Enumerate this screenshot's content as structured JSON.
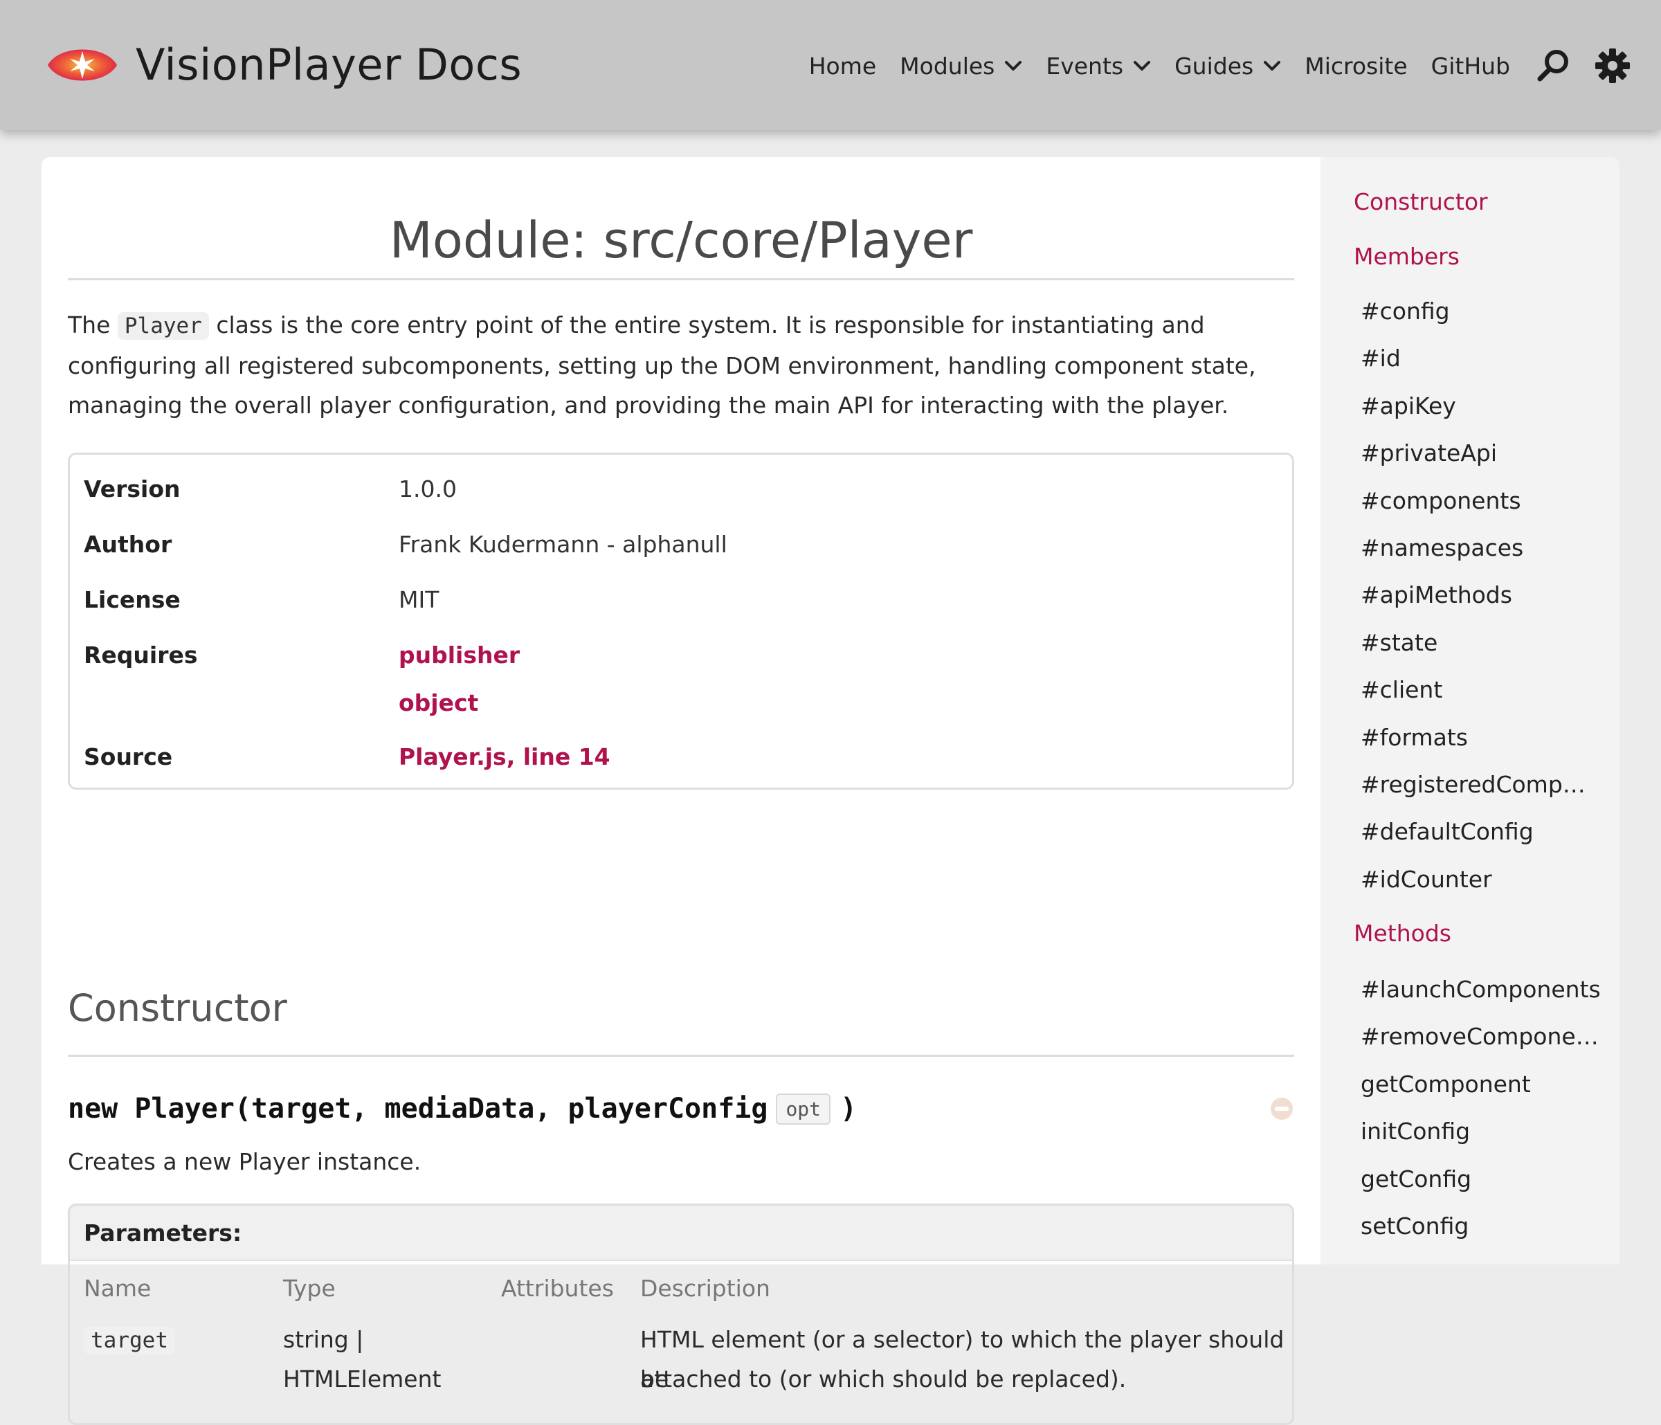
{
  "header": {
    "brand": "VisionPlayer Docs",
    "nav": [
      {
        "label": "Home",
        "dropdown": false
      },
      {
        "label": "Modules",
        "dropdown": true
      },
      {
        "label": "Events",
        "dropdown": true
      },
      {
        "label": "Guides",
        "dropdown": true
      },
      {
        "label": "Microsite",
        "dropdown": false
      },
      {
        "label": "GitHub",
        "dropdown": false
      }
    ],
    "icons": [
      "search-icon",
      "gear-icon"
    ]
  },
  "page": {
    "title": "Module: src/core/Player",
    "intro_before": "The ",
    "intro_code": "Player",
    "intro_after": " class is the core entry point of the entire system. It is responsible for instantiating and configuring all registered subcomponents, setting up the DOM environment, handling component state, managing the overall player configuration, and providing the main API for interacting with the player.",
    "meta": {
      "version_label": "Version",
      "version_value": "1.0.0",
      "author_label": "Author",
      "author_value": "Frank Kudermann - alphanull",
      "license_label": "License",
      "license_value": "MIT",
      "requires_label": "Requires",
      "requires_values": [
        "publisher",
        "object"
      ],
      "source_label": "Source",
      "source_file": "Player.js",
      "source_sep": ", ",
      "source_line": "line 14"
    },
    "constructor": {
      "section_title": "Constructor",
      "signature_before": "new Player(target, mediaData, playerConfig",
      "signature_badge": "opt",
      "signature_after": ")",
      "description": "Creates a new Player instance.",
      "params_title": "Parameters:",
      "columns": [
        "Name",
        "Type",
        "Attributes",
        "Description"
      ],
      "rows": [
        {
          "name": "target",
          "type_line1": "string |",
          "type_line2": "HTMLElement",
          "attributes": "",
          "desc_line1": "HTML element (or a selector) to which the player should be",
          "desc_line2": "attached to (or which should be replaced)."
        }
      ]
    }
  },
  "sidebar": {
    "constructor_heading": "Constructor",
    "members_heading": "Members",
    "members": [
      "#config",
      "#id",
      "#apiKey",
      "#privateApi",
      "#components",
      "#namespaces",
      "#apiMethods",
      "#state",
      "#client",
      "#formats",
      "#registeredComp…",
      "#defaultConfig",
      "#idCounter"
    ],
    "methods_heading": "Methods",
    "methods": [
      "#launchComponents",
      "#removeCompone…",
      "getComponent",
      "initConfig",
      "getConfig",
      "setConfig"
    ]
  },
  "colors": {
    "accent": "#b0124e",
    "header_bg": "#c6c6c6",
    "logo_red": "#e6334a",
    "logo_orange": "#f7a13a"
  }
}
